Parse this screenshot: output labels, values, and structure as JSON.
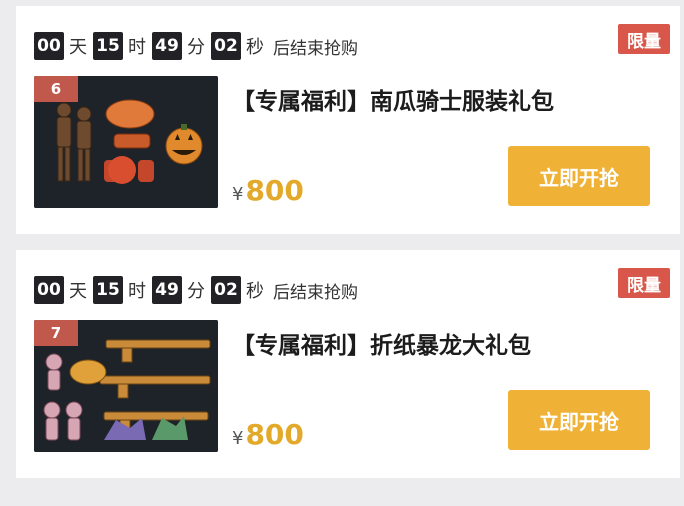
{
  "products": [
    {
      "countdown": {
        "days": "00",
        "days_unit": "天",
        "hours": "15",
        "hours_unit": "时",
        "minutes": "49",
        "minutes_unit": "分",
        "seconds": "02",
        "seconds_unit": "秒",
        "suffix": "后结束抢购"
      },
      "badge": "限量",
      "rank": "6",
      "title": "【专属福利】南瓜骑士服装礼包",
      "currency": "¥",
      "price": "800",
      "buy_label": "立即开抢"
    },
    {
      "countdown": {
        "days": "00",
        "days_unit": "天",
        "hours": "15",
        "hours_unit": "时",
        "minutes": "49",
        "minutes_unit": "分",
        "seconds": "02",
        "seconds_unit": "秒",
        "suffix": "后结束抢购"
      },
      "badge": "限量",
      "rank": "7",
      "title": "【专属福利】折纸暴龙大礼包",
      "currency": "¥",
      "price": "800",
      "buy_label": "立即开抢"
    }
  ],
  "colors": {
    "accent": "#f0b236",
    "price": "#e3a92a",
    "badge": "#d9574a",
    "timer_bg": "#222226"
  }
}
